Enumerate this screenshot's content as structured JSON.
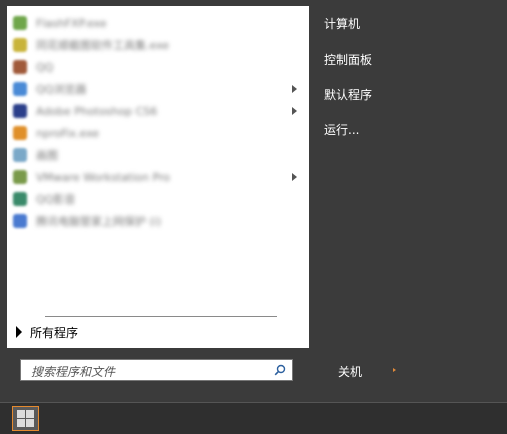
{
  "start_menu": {
    "programs": [
      {
        "label": "FlashFXP.exe",
        "icon_color": "#6fa64a",
        "has_submenu": false
      },
      {
        "label": "同花顺截图软件工具集.exe",
        "icon_color": "#c9b43a",
        "has_submenu": false
      },
      {
        "label": "QQ",
        "icon_color": "#a05a3a",
        "has_submenu": false
      },
      {
        "label": "QQ浏览器",
        "icon_color": "#4a8ad6",
        "has_submenu": true
      },
      {
        "label": "Adobe Photoshop CS6",
        "icon_color": "#2b3f8a",
        "has_submenu": true
      },
      {
        "label": "nproFix.exe",
        "icon_color": "#e0902a",
        "has_submenu": false
      },
      {
        "label": "画图",
        "icon_color": "#7aa8c8",
        "has_submenu": false
      },
      {
        "label": "VMware Workstation Pro",
        "icon_color": "#7a9a4a",
        "has_submenu": true
      },
      {
        "label": "QQ影音",
        "icon_color": "#3a8a6a",
        "has_submenu": false
      },
      {
        "label": "腾讯电脑管家上网保护 (i)",
        "icon_color": "#4a7ad0",
        "has_submenu": false
      }
    ],
    "all_programs_label": "所有程序",
    "right_links": [
      "计算机",
      "控制面板",
      "默认程序",
      "运行..."
    ],
    "search": {
      "placeholder": "搜索程序和文件"
    },
    "shutdown_label": "关机"
  },
  "colors": {
    "background": "#3b3b3b",
    "panel": "#ffffff",
    "start_button_border": "#e58a2f",
    "shutdown_arrow": "#e08a3a"
  },
  "icons": {
    "search": "magnifier-icon",
    "start": "windows-logo-icon"
  }
}
